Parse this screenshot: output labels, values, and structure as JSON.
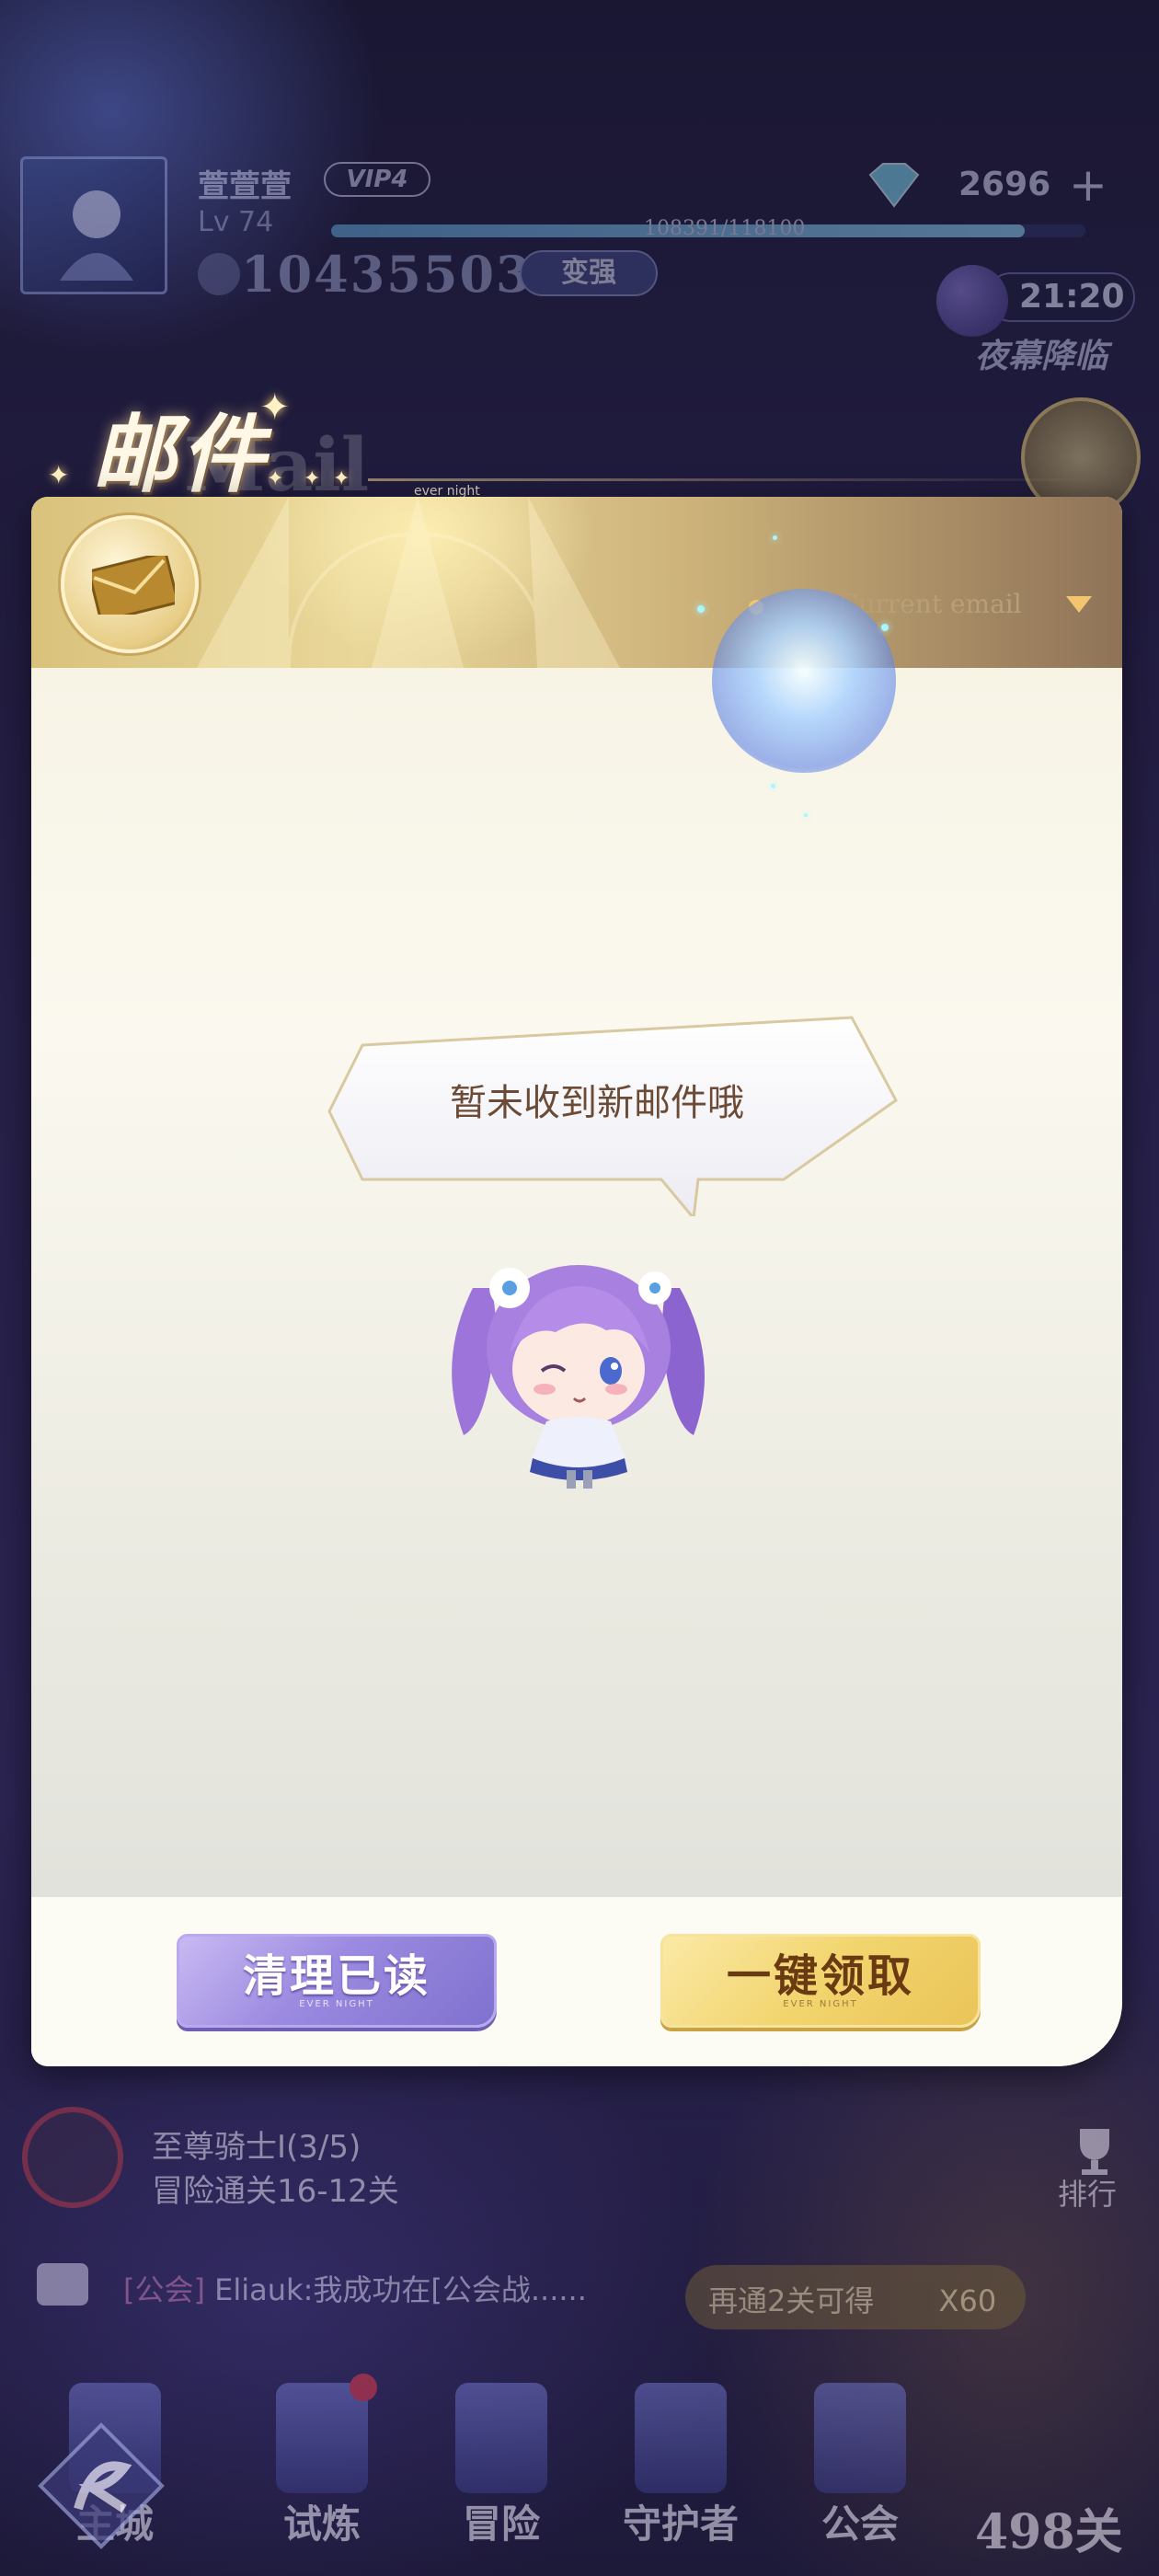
{
  "hud": {
    "player_name": "萱萱萱",
    "vip": "VIP4",
    "level": "Lv 74",
    "exp_text": "108391/118100",
    "exp_ratio": 0.92,
    "power": "10435503",
    "enhance_label": "变强",
    "gems": "2696",
    "gem_plus": "+",
    "clock": "21:20",
    "event_name": "夜幕降临"
  },
  "mail": {
    "title": "邮件",
    "title_ghost": "Mail",
    "tiny_tag": "ever night",
    "filter_label": "Current email",
    "empty_message": "暂未收到新邮件哦",
    "clear_read_label": "清理已读",
    "clear_read_sub": "EVER NIGHT",
    "claim_all_label": "一键领取",
    "claim_all_sub": "EVER NIGHT"
  },
  "bottom": {
    "quest_title": "至尊骑士I(3/5)",
    "quest_sub": "冒险通关16-12关",
    "rank_label": "排行",
    "chat_tag": "[公会]",
    "chat_text": "Eliauk:我成功在[公会战......",
    "reward_text": "再通2关可得",
    "reward_qty": "X60",
    "stage_count": "498关",
    "nav": [
      "主城",
      "试炼",
      "冒险",
      "守护者",
      "公会"
    ]
  },
  "colors": {
    "accent_gold": "#e9d79a",
    "button_purple": "#9b8ae0",
    "button_gold": "#f2d56e",
    "empty_text": "#6b4a36"
  }
}
